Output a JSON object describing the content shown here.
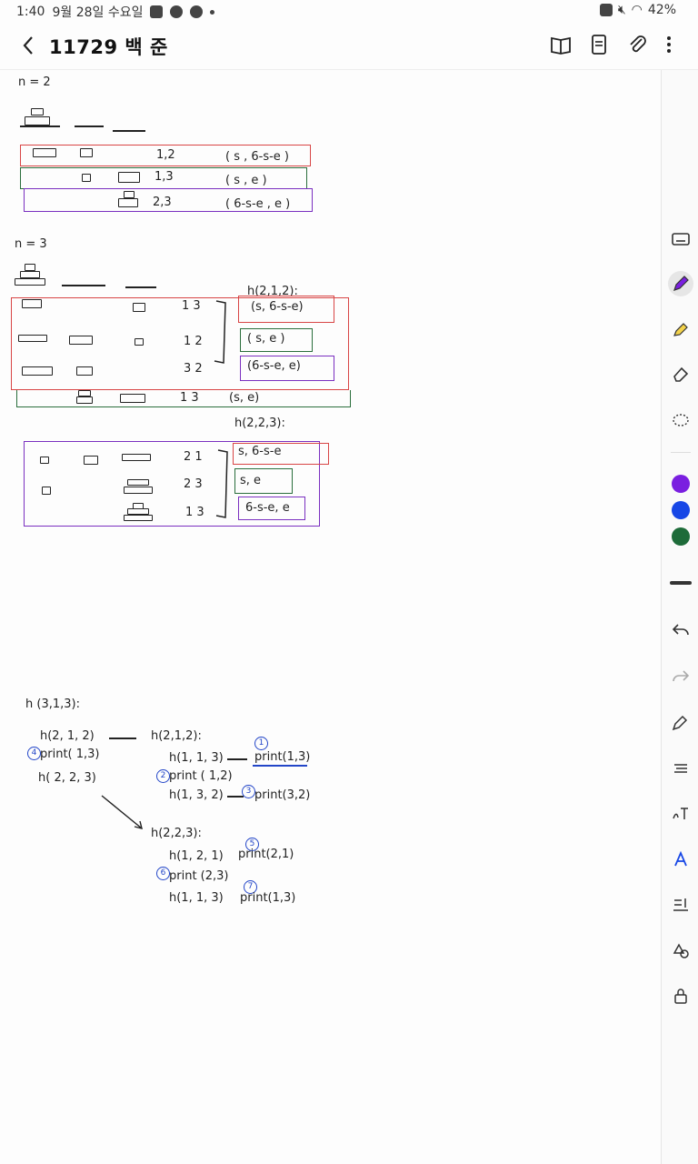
{
  "status": {
    "time": "1:40",
    "date": "9월 28일 수요일",
    "battery": "42%"
  },
  "header": {
    "title": "11729 백 준"
  },
  "notes": {
    "n2_label": "n = 2",
    "n2_rows": [
      {
        "move": "1,2",
        "args": "( s , 6-s-e )"
      },
      {
        "move": "1,3",
        "args": "( s , e )"
      },
      {
        "move": "2,3",
        "args": "( 6-s-e , e )"
      }
    ],
    "n3_label": "n = 3",
    "n3_call1": "h(2,1,2):",
    "n3_block1": [
      {
        "move": "1 3",
        "args": "(s, 6-s-e)"
      },
      {
        "move": "1 2",
        "args": "( s, e )"
      },
      {
        "move": "3 2",
        "args": "(6-s-e, e)"
      }
    ],
    "n3_mid": {
      "move": "1 3",
      "args": "(s, e)"
    },
    "n3_call2": "h(2,2,3):",
    "n3_block2": [
      {
        "move": "2 1",
        "args": "s, 6-s-e"
      },
      {
        "move": "2 3",
        "args": "s, e"
      },
      {
        "move": "1 3",
        "args": "6-s-e, e"
      }
    ],
    "trace": {
      "root": "h (3,1,3):",
      "c1": "h(2, 1, 2)",
      "c2": "print( 1,3)",
      "c3": "h( 2, 2, 3)",
      "s1_head": "h(2,1,2):",
      "s1_a": "h(1, 1, 3)",
      "s1_a_out": "print(1,3)",
      "s1_b": "print ( 1,2)",
      "s1_c": "h(1, 3, 2)",
      "s1_c_out": "print(3,2)",
      "s2_head": "h(2,2,3):",
      "s2_a": "h(1, 2, 1)",
      "s2_a_out": "print(2,1)",
      "s2_b": "print (2,3)",
      "s2_c": "h(1, 1, 3)",
      "s2_c_out": "print(1,3)",
      "n1": "1",
      "n2": "2",
      "n3": "3",
      "n4": "4",
      "n5": "5",
      "n6": "6",
      "n7": "7"
    }
  },
  "colors": {
    "red": "#d84545",
    "green": "#2a6e3c",
    "purple": "#7a2fc0",
    "blue": "#2346c8",
    "swatch1": "#7a1fe0",
    "swatch2": "#1747e6",
    "swatch3": "#1d6b39"
  }
}
